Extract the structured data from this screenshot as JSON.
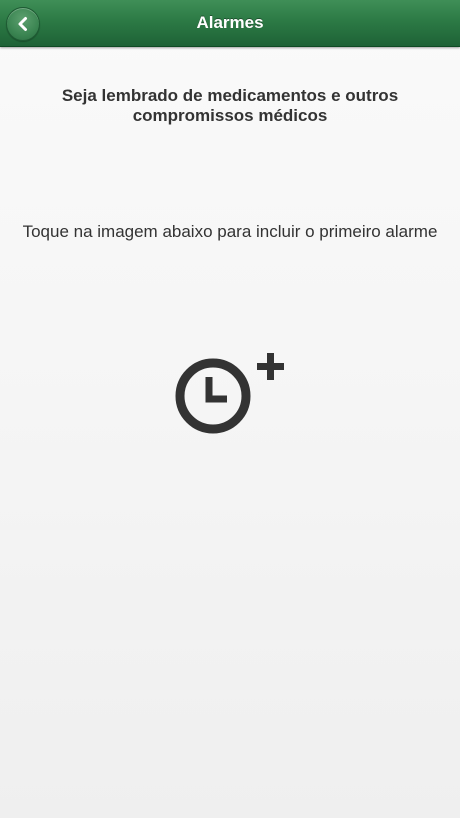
{
  "header": {
    "title": "Alarmes",
    "back_icon": "chevron-left-icon"
  },
  "main": {
    "heading": "Seja lembrado de medicamentos e outros compromissos médicos",
    "instruction": "Toque na imagem abaixo para incluir o primeiro alarme",
    "add_alarm_icon": "clock-plus-icon"
  },
  "colors": {
    "header_green": "#2c7a45",
    "text": "#333333",
    "icon": "#333333"
  }
}
